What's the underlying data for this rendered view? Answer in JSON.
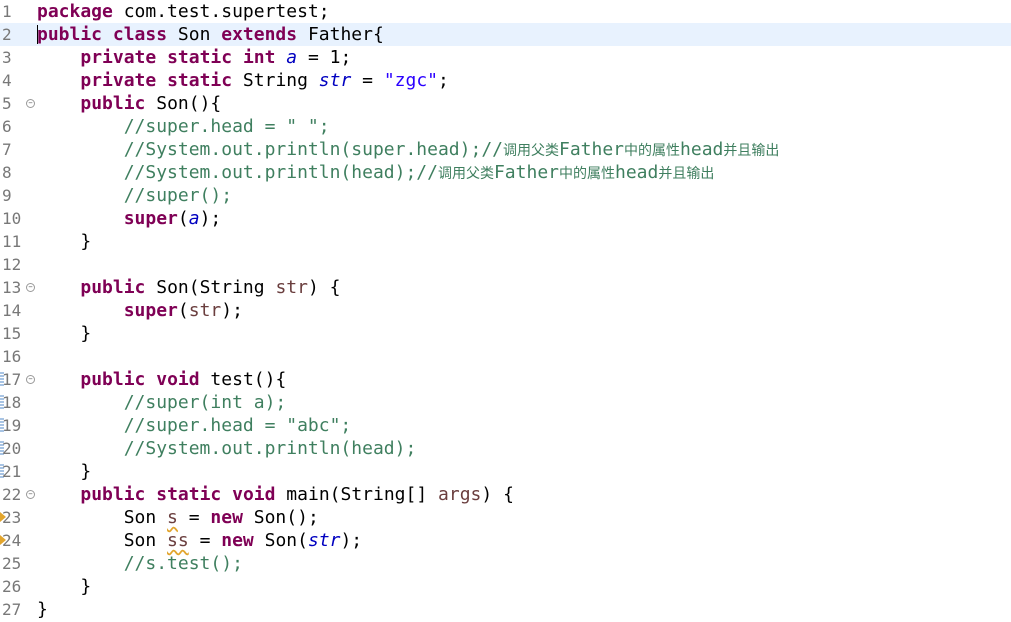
{
  "editor": {
    "lines": [
      {
        "num": "1",
        "tokens": [
          {
            "t": "package",
            "s": "kw"
          },
          {
            "t": " com.test.supertest;",
            "s": "plain"
          }
        ]
      },
      {
        "num": "2",
        "current": true,
        "tokens": [
          {
            "t": "public",
            "s": "kw"
          },
          {
            "t": " ",
            "s": "plain"
          },
          {
            "t": "class",
            "s": "kw"
          },
          {
            "t": " Son ",
            "s": "plain"
          },
          {
            "t": "extends",
            "s": "kw"
          },
          {
            "t": " Father{",
            "s": "plain"
          }
        ]
      },
      {
        "num": "3",
        "tokens": [
          {
            "t": "    ",
            "s": "plain"
          },
          {
            "t": "private",
            "s": "kw"
          },
          {
            "t": " ",
            "s": "plain"
          },
          {
            "t": "static",
            "s": "kw"
          },
          {
            "t": " ",
            "s": "plain"
          },
          {
            "t": "int",
            "s": "kw"
          },
          {
            "t": " ",
            "s": "plain"
          },
          {
            "t": "a",
            "s": "field"
          },
          {
            "t": " = 1;",
            "s": "plain"
          }
        ]
      },
      {
        "num": "4",
        "tokens": [
          {
            "t": "    ",
            "s": "plain"
          },
          {
            "t": "private",
            "s": "kw"
          },
          {
            "t": " ",
            "s": "plain"
          },
          {
            "t": "static",
            "s": "kw"
          },
          {
            "t": " String ",
            "s": "plain"
          },
          {
            "t": "str",
            "s": "field"
          },
          {
            "t": " = ",
            "s": "plain"
          },
          {
            "t": "\"zgc\"",
            "s": "str"
          },
          {
            "t": ";",
            "s": "plain"
          }
        ]
      },
      {
        "num": "5",
        "fold": true,
        "tokens": [
          {
            "t": "    ",
            "s": "plain"
          },
          {
            "t": "public",
            "s": "kw"
          },
          {
            "t": " Son(){",
            "s": "plain"
          }
        ]
      },
      {
        "num": "6",
        "tokens": [
          {
            "t": "        //super.head = \" \";",
            "s": "comment"
          }
        ]
      },
      {
        "num": "7",
        "tokens": [
          {
            "t": "        //System.out.println(super.head);//",
            "s": "comment"
          },
          {
            "t": "调用父类",
            "s": "comment-cjk"
          },
          {
            "t": "Father",
            "s": "comment"
          },
          {
            "t": "中的属性",
            "s": "comment-cjk"
          },
          {
            "t": "head",
            "s": "comment"
          },
          {
            "t": "并且输出",
            "s": "comment-cjk"
          }
        ]
      },
      {
        "num": "8",
        "tokens": [
          {
            "t": "        //System.out.println(head);//",
            "s": "comment"
          },
          {
            "t": "调用父类",
            "s": "comment-cjk"
          },
          {
            "t": "Father",
            "s": "comment"
          },
          {
            "t": "中的属性",
            "s": "comment-cjk"
          },
          {
            "t": "head",
            "s": "comment"
          },
          {
            "t": "并且输出",
            "s": "comment-cjk"
          }
        ]
      },
      {
        "num": "9",
        "tokens": [
          {
            "t": "        //super();",
            "s": "comment"
          }
        ]
      },
      {
        "num": "10",
        "tokens": [
          {
            "t": "        ",
            "s": "plain"
          },
          {
            "t": "super",
            "s": "kw"
          },
          {
            "t": "(",
            "s": "plain"
          },
          {
            "t": "a",
            "s": "field"
          },
          {
            "t": ");",
            "s": "plain"
          }
        ]
      },
      {
        "num": "11",
        "tokens": [
          {
            "t": "    }",
            "s": "plain"
          }
        ]
      },
      {
        "num": "12",
        "tokens": []
      },
      {
        "num": "13",
        "fold": true,
        "tokens": [
          {
            "t": "    ",
            "s": "plain"
          },
          {
            "t": "public",
            "s": "kw"
          },
          {
            "t": " Son(String ",
            "s": "plain"
          },
          {
            "t": "str",
            "s": "local"
          },
          {
            "t": ") {",
            "s": "plain"
          }
        ]
      },
      {
        "num": "14",
        "tokens": [
          {
            "t": "        ",
            "s": "plain"
          },
          {
            "t": "super",
            "s": "kw"
          },
          {
            "t": "(",
            "s": "plain"
          },
          {
            "t": "str",
            "s": "local"
          },
          {
            "t": ");",
            "s": "plain"
          }
        ]
      },
      {
        "num": "15",
        "tokens": [
          {
            "t": "    }",
            "s": "plain"
          }
        ]
      },
      {
        "num": "16",
        "tokens": []
      },
      {
        "num": "17",
        "fold": true,
        "marker": "blue",
        "tokens": [
          {
            "t": "    ",
            "s": "plain"
          },
          {
            "t": "public",
            "s": "kw"
          },
          {
            "t": " ",
            "s": "plain"
          },
          {
            "t": "void",
            "s": "kw"
          },
          {
            "t": " test(){",
            "s": "plain"
          }
        ]
      },
      {
        "num": "18",
        "marker": "blue",
        "tokens": [
          {
            "t": "        //super(int a);",
            "s": "comment"
          }
        ]
      },
      {
        "num": "19",
        "marker": "blue",
        "tokens": [
          {
            "t": "        //super.head = \"abc\";",
            "s": "comment"
          }
        ]
      },
      {
        "num": "20",
        "marker": "blue",
        "tokens": [
          {
            "t": "        //System.out.println(head);",
            "s": "comment"
          }
        ]
      },
      {
        "num": "21",
        "marker": "blue",
        "tokens": [
          {
            "t": "    }",
            "s": "plain"
          }
        ]
      },
      {
        "num": "22",
        "fold": true,
        "tokens": [
          {
            "t": "    ",
            "s": "plain"
          },
          {
            "t": "public",
            "s": "kw"
          },
          {
            "t": " ",
            "s": "plain"
          },
          {
            "t": "static",
            "s": "kw"
          },
          {
            "t": " ",
            "s": "plain"
          },
          {
            "t": "void",
            "s": "kw"
          },
          {
            "t": " main(String[] ",
            "s": "plain"
          },
          {
            "t": "args",
            "s": "local"
          },
          {
            "t": ") {",
            "s": "plain"
          }
        ]
      },
      {
        "num": "23",
        "marker": "warn",
        "tokens": [
          {
            "t": "        Son ",
            "s": "plain"
          },
          {
            "t": "s",
            "s": "local-warn"
          },
          {
            "t": " = ",
            "s": "plain"
          },
          {
            "t": "new",
            "s": "kw"
          },
          {
            "t": " Son();",
            "s": "plain"
          }
        ]
      },
      {
        "num": "24",
        "marker": "warn",
        "tokens": [
          {
            "t": "        Son ",
            "s": "plain"
          },
          {
            "t": "ss",
            "s": "local-warn"
          },
          {
            "t": " = ",
            "s": "plain"
          },
          {
            "t": "new",
            "s": "kw"
          },
          {
            "t": " Son(",
            "s": "plain"
          },
          {
            "t": "str",
            "s": "field"
          },
          {
            "t": ");",
            "s": "plain"
          }
        ]
      },
      {
        "num": "25",
        "tokens": [
          {
            "t": "        //s.test();",
            "s": "comment"
          }
        ]
      },
      {
        "num": "26",
        "tokens": [
          {
            "t": "    }",
            "s": "plain"
          }
        ]
      },
      {
        "num": "27",
        "tokens": [
          {
            "t": "}",
            "s": "plain"
          }
        ]
      }
    ]
  },
  "colors": {
    "keyword": "#7f0055",
    "string": "#2a00ff",
    "field": "#0000c0",
    "local": "#6a3e3e",
    "comment": "#3f7f5f",
    "current_line": "#e8f2fe",
    "warning": "#e2a52d"
  },
  "icons": {
    "fold": "fold-collapse-icon",
    "warning": "warning-marker-icon",
    "change": "change-marker-icon"
  }
}
